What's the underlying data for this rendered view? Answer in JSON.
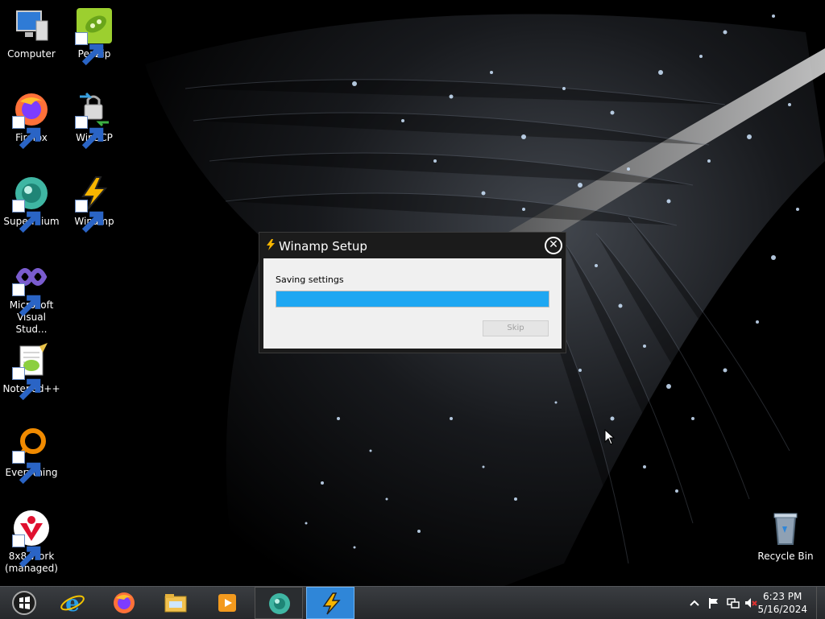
{
  "desktop": {
    "icons": [
      {
        "label": "Computer"
      },
      {
        "label": "PeaZip"
      },
      {
        "label": "Firefox"
      },
      {
        "label": "WinSCP"
      },
      {
        "label": "Supermium"
      },
      {
        "label": "Winamp"
      },
      {
        "label": "Microsoft Visual Stud..."
      },
      {
        "label": "Notepad++"
      },
      {
        "label": "Everything"
      },
      {
        "label": "8x8 Work (managed)"
      },
      {
        "label": "Recycle Bin"
      }
    ]
  },
  "dialog": {
    "title": "Winamp Setup",
    "status": "Saving settings",
    "progress_percent": 100,
    "skip_label": "Skip",
    "accent": "#1ea7f2"
  },
  "taskbar": {
    "pinned": [
      {
        "name": "internet-explorer"
      },
      {
        "name": "firefox"
      },
      {
        "name": "file-explorer"
      },
      {
        "name": "media-player"
      },
      {
        "name": "supermium"
      },
      {
        "name": "winamp"
      }
    ],
    "clock": {
      "time": "6:23 PM",
      "date": "5/16/2024"
    }
  }
}
